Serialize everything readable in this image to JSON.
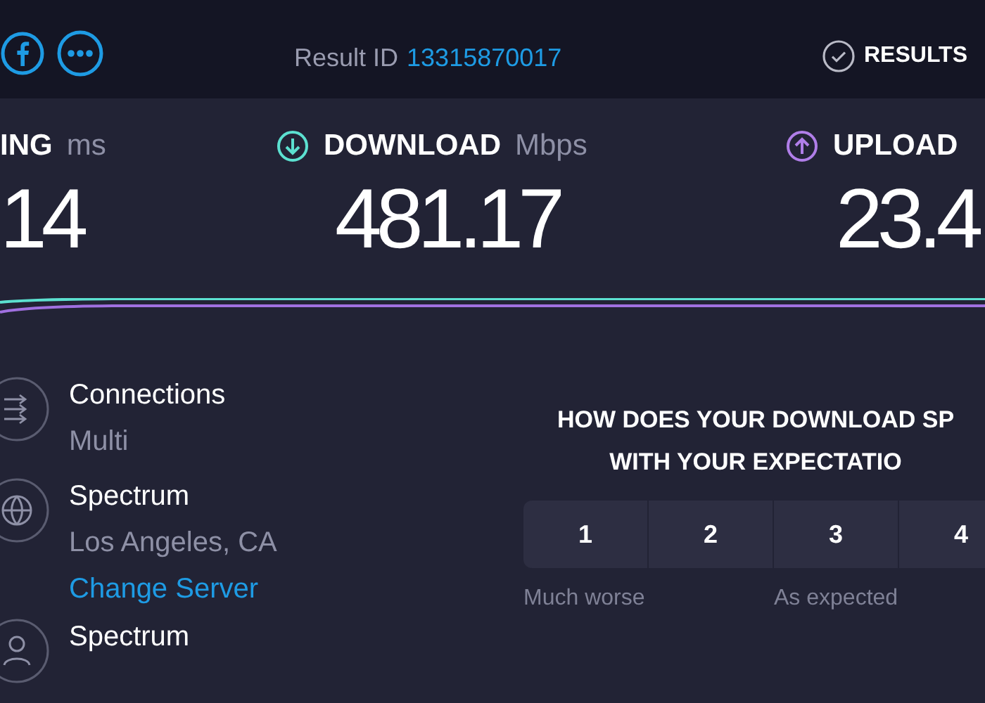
{
  "header": {
    "result_id_label": "Result ID",
    "result_id": "13315870017",
    "results_label": "RESULTS"
  },
  "metrics": [
    {
      "kind": "ping",
      "label": "ING",
      "unit": "ms",
      "value": "14"
    },
    {
      "kind": "download",
      "label": "DOWNLOAD",
      "unit": "Mbps",
      "value": "481.17"
    },
    {
      "kind": "upload",
      "label": "UPLOAD",
      "value": "23.4"
    }
  ],
  "info": [
    {
      "kind": "connections",
      "title": "Connections",
      "lines": [
        "Multi"
      ]
    },
    {
      "kind": "server",
      "title": "Spectrum",
      "lines": [
        "Los Angeles, CA"
      ],
      "link": "Change Server"
    },
    {
      "kind": "provider",
      "title": "Spectrum"
    }
  ],
  "survey": {
    "question": [
      "HOW DOES YOUR DOWNLOAD SP",
      "WITH YOUR EXPECTATIO"
    ],
    "options": [
      "1",
      "2",
      "3",
      "4"
    ],
    "scale_labels": [
      "Much worse",
      "As expected"
    ]
  }
}
